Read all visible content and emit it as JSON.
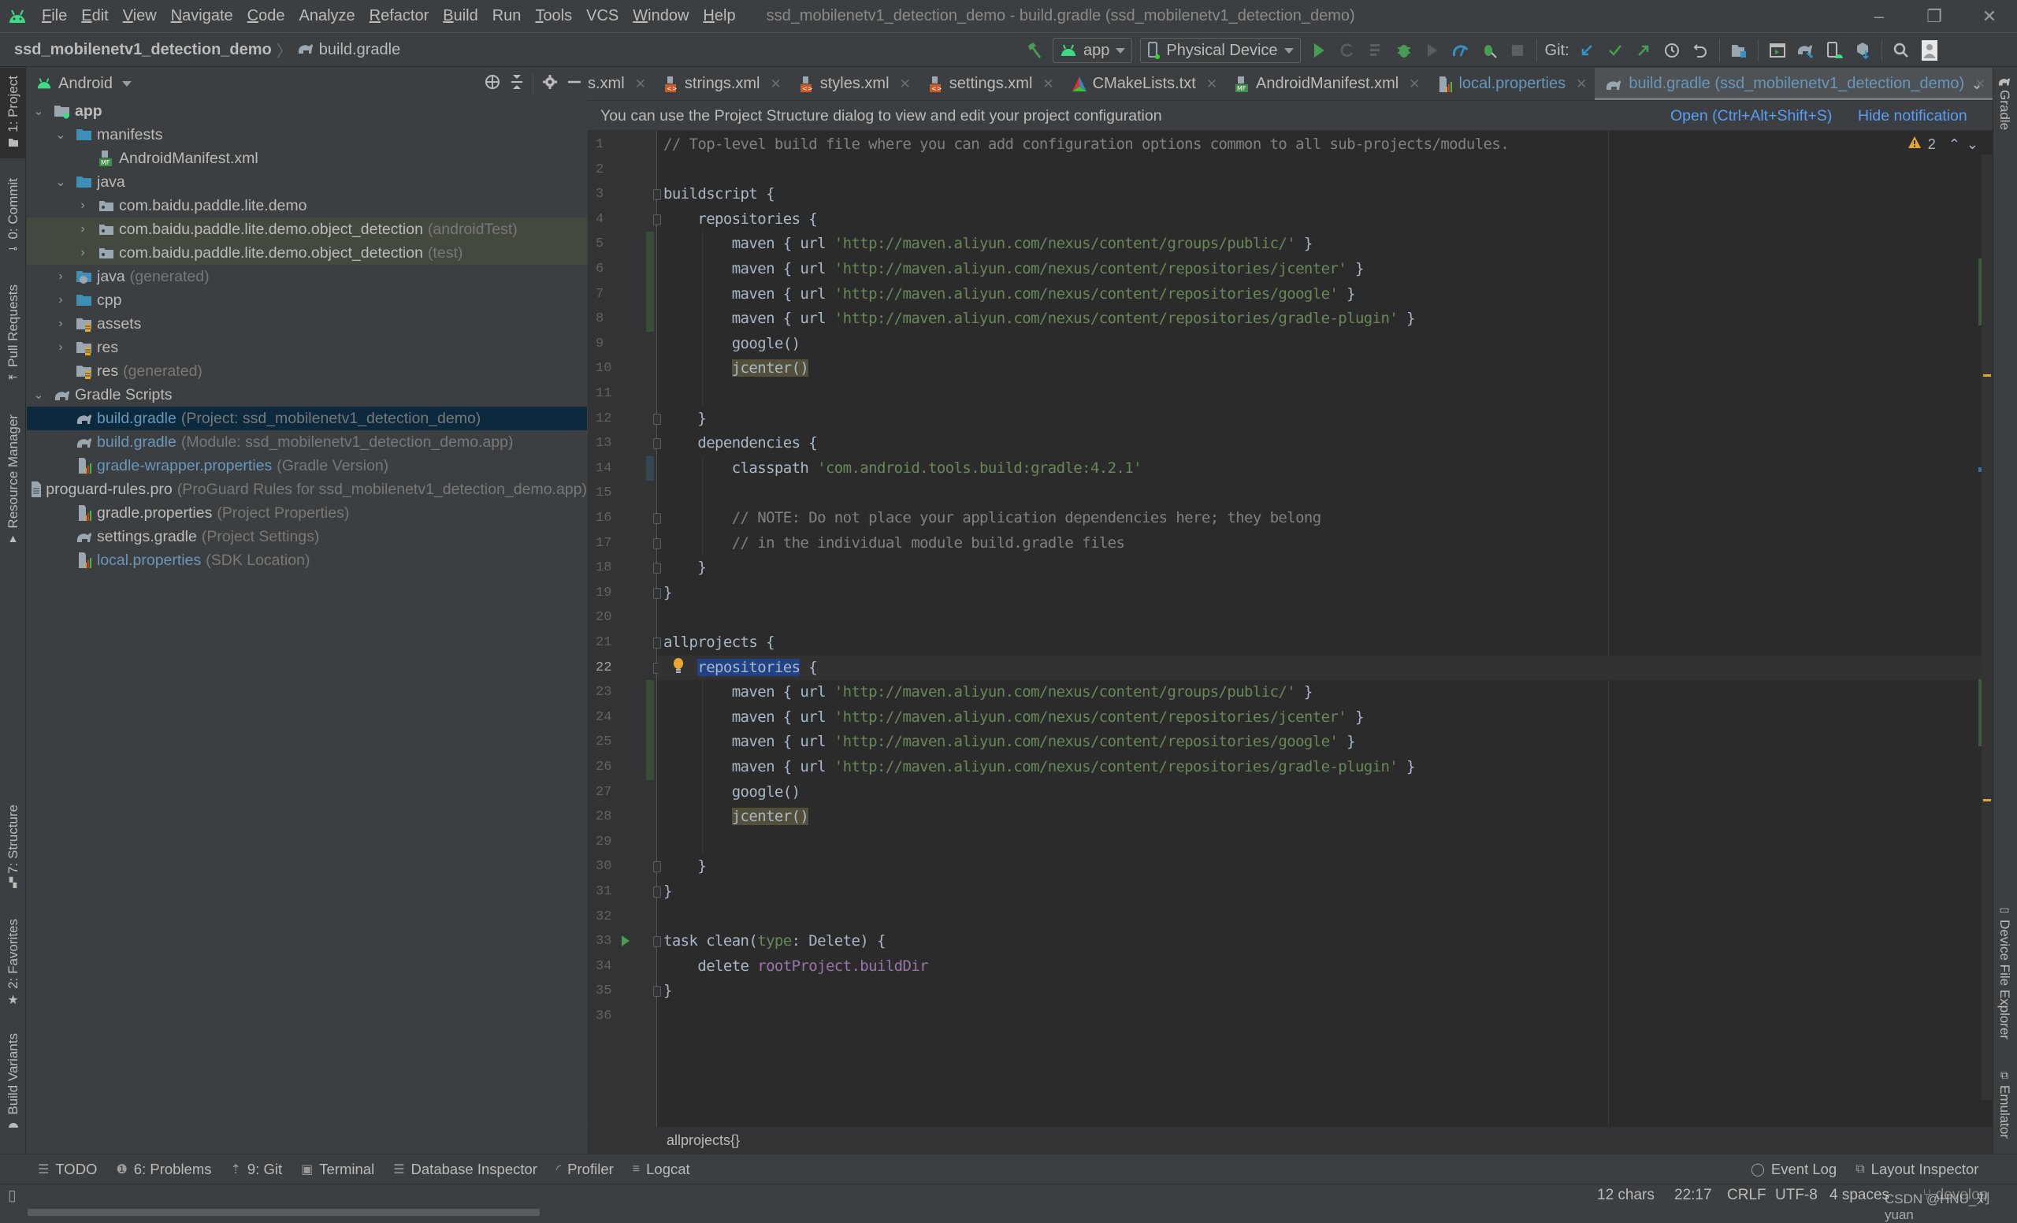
{
  "window": {
    "title": "ssd_mobilenetv1_detection_demo - build.gradle (ssd_mobilenetv1_detection_demo)",
    "controls": {
      "minimize": "–",
      "restore": "❐",
      "close": "✕"
    }
  },
  "menu": [
    {
      "label": "File",
      "mnemonic": "F",
      "rest": "ile"
    },
    {
      "label": "Edit",
      "mnemonic": "E",
      "rest": "dit"
    },
    {
      "label": "View",
      "mnemonic": "V",
      "rest": "iew"
    },
    {
      "label": "Navigate",
      "mnemonic": "N",
      "rest": "avigate"
    },
    {
      "label": "Code",
      "mnemonic": "C",
      "rest": "ode"
    },
    {
      "label": "Analyze",
      "mnemonic": "",
      "rest": "Analyze"
    },
    {
      "label": "Refactor",
      "mnemonic": "R",
      "rest": "efactor"
    },
    {
      "label": "Build",
      "mnemonic": "B",
      "rest": "uild"
    },
    {
      "label": "Run",
      "mnemonic": "",
      "rest": "Run"
    },
    {
      "label": "Tools",
      "mnemonic": "T",
      "rest": "ools"
    },
    {
      "label": "VCS",
      "mnemonic": "",
      "rest": "VCS"
    },
    {
      "label": "Window",
      "mnemonic": "W",
      "rest": "indow"
    },
    {
      "label": "Help",
      "mnemonic": "H",
      "rest": "elp"
    }
  ],
  "navbar": {
    "project": "ssd_mobilenetv1_detection_demo",
    "separator": "〉",
    "file": "build.gradle"
  },
  "toolbar": {
    "run_config": "app",
    "device": "Physical Device",
    "git_label": "Git:"
  },
  "left_tool_windows": [
    {
      "label": "1: Project",
      "active": true
    },
    {
      "label": "0: Commit"
    },
    {
      "label": "Pull Requests"
    },
    {
      "label": "Resource Manager"
    },
    {
      "label": "7: Structure"
    },
    {
      "label": "2: Favorites"
    },
    {
      "label": "Build Variants"
    }
  ],
  "right_tool_windows": [
    {
      "label": "Gradle"
    },
    {
      "label": "Device File Explorer"
    },
    {
      "label": "Emulator"
    }
  ],
  "project_panel": {
    "view_mode": "Android",
    "tree": [
      {
        "depth": 0,
        "expanded": true,
        "icon": "module",
        "name": "app",
        "bold": true
      },
      {
        "depth": 1,
        "expanded": true,
        "icon": "folder",
        "name": "manifests"
      },
      {
        "depth": 2,
        "icon": "manifest-file",
        "name": "AndroidManifest.xml"
      },
      {
        "depth": 1,
        "expanded": true,
        "icon": "folder",
        "name": "java"
      },
      {
        "depth": 2,
        "expanded": false,
        "icon": "package",
        "name": "com.baidu.paddle.lite.demo"
      },
      {
        "depth": 2,
        "expanded": false,
        "icon": "package",
        "name": "com.baidu.paddle.lite.demo.object_detection",
        "hint": "(androidTest)",
        "highlight": "green"
      },
      {
        "depth": 2,
        "expanded": false,
        "icon": "package",
        "name": "com.baidu.paddle.lite.demo.object_detection",
        "hint": "(test)",
        "highlight": "green"
      },
      {
        "depth": 1,
        "expanded": false,
        "icon": "generated-folder",
        "name": "java",
        "hint": "(generated)"
      },
      {
        "depth": 1,
        "expanded": false,
        "icon": "folder",
        "name": "cpp"
      },
      {
        "depth": 1,
        "expanded": false,
        "icon": "res-folder",
        "name": "assets"
      },
      {
        "depth": 1,
        "expanded": false,
        "icon": "res-folder",
        "name": "res"
      },
      {
        "depth": 1,
        "icon": "res-folder",
        "name": "res",
        "hint": "(generated)"
      },
      {
        "depth": 0,
        "expanded": true,
        "icon": "gradle",
        "name": "Gradle Scripts"
      },
      {
        "depth": 1,
        "icon": "gradle",
        "name": "build.gradle",
        "hint": "(Project: ssd_mobilenetv1_detection_demo)",
        "blue": true,
        "selected": true
      },
      {
        "depth": 1,
        "icon": "gradle",
        "name": "build.gradle",
        "hint": "(Module: ssd_mobilenetv1_detection_demo.app)",
        "blue": true
      },
      {
        "depth": 1,
        "icon": "properties",
        "name": "gradle-wrapper.properties",
        "hint": "(Gradle Version)",
        "blue": true
      },
      {
        "depth": 1,
        "icon": "text-file",
        "name": "proguard-rules.pro",
        "hint": "(ProGuard Rules for ssd_mobilenetv1_detection_demo.app)"
      },
      {
        "depth": 1,
        "icon": "properties",
        "name": "gradle.properties",
        "hint": "(Project Properties)"
      },
      {
        "depth": 1,
        "icon": "gradle",
        "name": "settings.gradle",
        "hint": "(Project Settings)"
      },
      {
        "depth": 1,
        "icon": "properties",
        "name": "local.properties",
        "hint": "(SDK Location)",
        "blue": true
      }
    ]
  },
  "tabs": [
    {
      "label": "s.xml",
      "icon": "none",
      "partial": true
    },
    {
      "label": "strings.xml",
      "icon": "xml-file"
    },
    {
      "label": "styles.xml",
      "icon": "xml-file"
    },
    {
      "label": "settings.xml",
      "icon": "xml-file"
    },
    {
      "label": "CMakeLists.txt",
      "icon": "cmake-file"
    },
    {
      "label": "AndroidManifest.xml",
      "icon": "manifest-file"
    },
    {
      "label": "local.properties",
      "icon": "properties",
      "blue": true
    },
    {
      "label": "build.gradle (ssd_mobilenetv1_detection_demo)",
      "icon": "gradle",
      "blue": true,
      "active": true
    }
  ],
  "notification": {
    "message": "You can use the Project Structure dialog to view and edit your project configuration",
    "open_label": "Open (Ctrl+Alt+Shift+S)",
    "hide_label": "Hide notification"
  },
  "editor": {
    "warnings_count": "2",
    "current_line": 22,
    "lines": [
      [
        {
          "t": "// Top-level build file where you can add configuration options common to all sub-projects/modules.",
          "c": "comment"
        }
      ],
      [],
      [
        {
          "t": "buildscript {"
        }
      ],
      [
        {
          "t": "    repositories {"
        }
      ],
      [
        {
          "t": "        maven { url "
        },
        {
          "t": "'http://maven.aliyun.com/nexus/content/groups/public/'",
          "c": "str"
        },
        {
          "t": " }"
        }
      ],
      [
        {
          "t": "        maven { url "
        },
        {
          "t": "'http://maven.aliyun.com/nexus/content/repositories/jcenter'",
          "c": "str"
        },
        {
          "t": " }"
        }
      ],
      [
        {
          "t": "        maven { url "
        },
        {
          "t": "'http://maven.aliyun.com/nexus/content/repositories/google'",
          "c": "str"
        },
        {
          "t": " }"
        }
      ],
      [
        {
          "t": "        maven { url "
        },
        {
          "t": "'http://maven.aliyun.com/nexus/content/repositories/gradle-plugin'",
          "c": "str"
        },
        {
          "t": " }"
        }
      ],
      [
        {
          "t": "        google()"
        }
      ],
      [
        {
          "t": "        "
        },
        {
          "t": "jcenter()",
          "c": "warn"
        }
      ],
      [],
      [
        {
          "t": "    }"
        }
      ],
      [
        {
          "t": "    dependencies {"
        }
      ],
      [
        {
          "t": "        classpath "
        },
        {
          "t": "'com.android.tools.build:gradle:4.2.1'",
          "c": "str"
        }
      ],
      [],
      [
        {
          "t": "        // NOTE: Do not place your application dependencies here; they belong",
          "c": "comment"
        }
      ],
      [
        {
          "t": "        // in the individual module build.gradle files",
          "c": "comment"
        }
      ],
      [
        {
          "t": "    }"
        }
      ],
      [
        {
          "t": "}"
        }
      ],
      [],
      [
        {
          "t": "allprojects {"
        }
      ],
      [
        {
          "t": "    "
        },
        {
          "t": "repositories",
          "c": "sel"
        },
        {
          "t": " {"
        }
      ],
      [
        {
          "t": "        maven { url "
        },
        {
          "t": "'http://maven.aliyun.com/nexus/content/groups/public/'",
          "c": "str"
        },
        {
          "t": " }"
        }
      ],
      [
        {
          "t": "        maven { url "
        },
        {
          "t": "'http://maven.aliyun.com/nexus/content/repositories/jcenter'",
          "c": "str"
        },
        {
          "t": " }"
        }
      ],
      [
        {
          "t": "        maven { url "
        },
        {
          "t": "'http://maven.aliyun.com/nexus/content/repositories/google'",
          "c": "str"
        },
        {
          "t": " }"
        }
      ],
      [
        {
          "t": "        maven { url "
        },
        {
          "t": "'http://maven.aliyun.com/nexus/content/repositories/gradle-plugin'",
          "c": "str"
        },
        {
          "t": " }"
        }
      ],
      [
        {
          "t": "        google()"
        }
      ],
      [
        {
          "t": "        "
        },
        {
          "t": "jcenter()",
          "c": "warn"
        }
      ],
      [],
      [
        {
          "t": "    }"
        }
      ],
      [
        {
          "t": "}"
        }
      ],
      [],
      [
        {
          "t": "task clean("
        },
        {
          "t": "type",
          "c": "named"
        },
        {
          "t": ": Delete) {"
        }
      ],
      [
        {
          "t": "    delete "
        },
        {
          "t": "rootProject.buildDir",
          "c": "prop"
        }
      ],
      [
        {
          "t": "}"
        }
      ],
      []
    ],
    "breadcrumb": "allprojects{}"
  },
  "bottom_tool_tabs": [
    {
      "label": "TODO",
      "icon": "list-icon"
    },
    {
      "label": "6: Problems",
      "icon": "problems-icon"
    },
    {
      "label": "9: Git",
      "icon": "git-icon"
    },
    {
      "label": "Terminal",
      "icon": "terminal-icon"
    },
    {
      "label": "Database Inspector",
      "icon": "database-icon"
    },
    {
      "label": "Profiler",
      "icon": "profiler-icon"
    },
    {
      "label": "Logcat",
      "icon": "logcat-icon"
    }
  ],
  "bottom_right_tabs": [
    {
      "label": "Event Log",
      "icon": "event-log-icon"
    },
    {
      "label": "Layout Inspector",
      "icon": "layout-inspector-icon"
    }
  ],
  "status": {
    "selection": "12 chars",
    "position": "22:17",
    "line_sep": "CRLF",
    "encoding": "UTF-8",
    "indent": "4 spaces",
    "branch": "develop",
    "watermark": "CSDN @HNU_刘yuan"
  },
  "colors": {
    "accent_green": "#3ddc84",
    "link_blue": "#589df6",
    "string_green": "#6a8759",
    "selection_blue": "#214283",
    "warning_yellow": "#e0a82e"
  }
}
